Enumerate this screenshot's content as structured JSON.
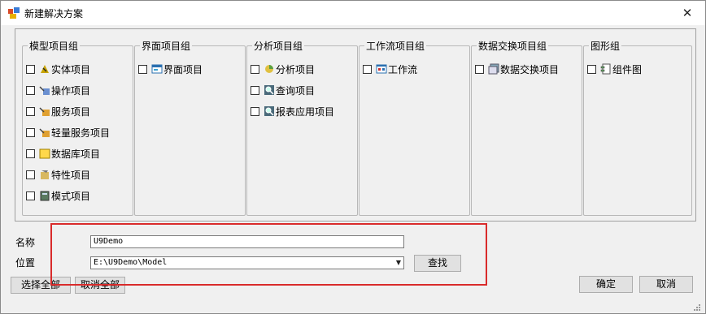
{
  "window": {
    "title": "新建解决方案",
    "close_glyph": "✕"
  },
  "groups": [
    {
      "title": "模型项目组",
      "items": [
        {
          "label": "实体项目",
          "icon": "entity-icon"
        },
        {
          "label": "操作项目",
          "icon": "operation-icon"
        },
        {
          "label": "服务项目",
          "icon": "service-icon"
        },
        {
          "label": "轻量服务项目",
          "icon": "lightweight-service-icon"
        },
        {
          "label": "数据库项目",
          "icon": "database-icon"
        },
        {
          "label": "特性项目",
          "icon": "attribute-icon"
        },
        {
          "label": "模式项目",
          "icon": "pattern-icon"
        }
      ]
    },
    {
      "title": "界面项目组",
      "items": [
        {
          "label": "界面项目",
          "icon": "ui-form-icon"
        }
      ]
    },
    {
      "title": "分析项目组",
      "items": [
        {
          "label": "分析项目",
          "icon": "analysis-icon"
        },
        {
          "label": "查询项目",
          "icon": "query-icon"
        },
        {
          "label": "报表应用项目",
          "icon": "report-icon"
        }
      ]
    },
    {
      "title": "工作流项目组",
      "items": [
        {
          "label": "工作流",
          "icon": "workflow-icon"
        }
      ]
    },
    {
      "title": "数据交换项目组",
      "items": [
        {
          "label": "数据交换项目",
          "icon": "data-exchange-icon"
        }
      ]
    },
    {
      "title": "图形组",
      "items": [
        {
          "label": "组件图",
          "icon": "component-diagram-icon"
        }
      ]
    }
  ],
  "form": {
    "name_label": "名称",
    "name_value": "U9Demo",
    "location_label": "位置",
    "location_value": "E:\\U9Demo\\Model",
    "browse_label": "查找"
  },
  "buttons": {
    "select_all": "选择全部",
    "deselect_all": "取消全部",
    "ok": "确定",
    "cancel": "取消"
  },
  "colors": {
    "highlight_border": "#d92b2b"
  }
}
